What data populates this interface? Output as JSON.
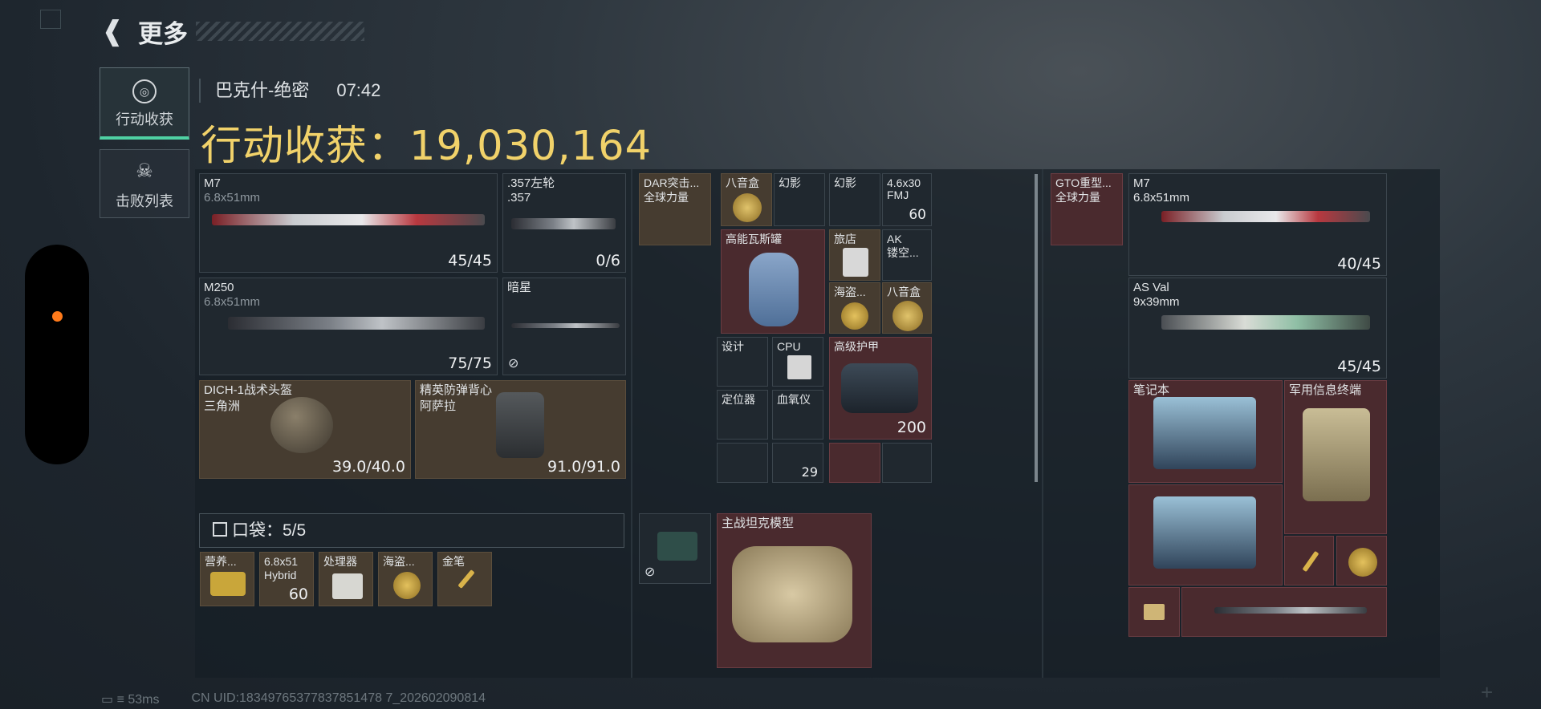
{
  "header": {
    "title": "更多"
  },
  "nav": {
    "tab1": "行动收获",
    "tab2": "击败列表"
  },
  "map": {
    "name": "巴克什-绝密",
    "time": "07:42"
  },
  "income": {
    "label": "行动收获：",
    "value": "19,030,164"
  },
  "weapons": [
    {
      "name": "M7",
      "ammo": "6.8x51mm",
      "count": "45/45"
    },
    {
      "name": ".357左轮",
      "ammo": ".357",
      "count": "0/6"
    },
    {
      "name": "M250",
      "ammo": "6.8x51mm",
      "count": "75/75"
    },
    {
      "name": "暗星"
    }
  ],
  "armor": [
    {
      "name": "DICH-1战术头盔",
      "sub": "三角洲",
      "dur": "39.0/40.0"
    },
    {
      "name": "精英防弹背心",
      "sub": "阿萨拉",
      "dur": "91.0/91.0"
    }
  ],
  "pocket": {
    "label": "口袋：5/5",
    "items": [
      "营养...",
      "6.8x51 Hybrid",
      "处理器",
      "海盗...",
      "金笔"
    ],
    "count2": "60"
  },
  "bag": {
    "rig": "DAR突击...",
    "rig_sub": "全球力量",
    "items": {
      "bayin1": "八音盒",
      "huanying1": "幻影",
      "huanying2": "幻影",
      "ammo46": "4.6x30",
      "ammo46_sub": "FMJ",
      "ammo46_count": "60",
      "gas": "高能瓦斯罐",
      "lvdian": "旅店",
      "ak": "AK",
      "ak_sub": "镂空...",
      "haidao": "海盗...",
      "bayin2": "八音盒",
      "sheji": "设计",
      "cpu": "CPU",
      "hujia": "高级护甲",
      "hujia_val": "200",
      "dingwei": "定位器",
      "xueyang": "血氧仪",
      "num29": "29",
      "tank": "主战坦克模型"
    }
  },
  "right": {
    "rig": "GTO重型...",
    "rig_sub": "全球力量",
    "m7": {
      "name": "M7",
      "ammo": "6.8x51mm",
      "count": "40/45"
    },
    "asval": {
      "name": "AS Val",
      "ammo": "9x39mm",
      "count": "45/45"
    },
    "laptop": "笔记本",
    "terminal": "军用信息终端"
  },
  "footer": {
    "ping": "53ms",
    "uid": "CN UID:18349765377837851478 7_202602090814"
  },
  "colors": {
    "accent": "#f1d26a",
    "green": "#4fd1a3",
    "red_bg": "#4a2a2e",
    "gold_bg": "#463c30"
  }
}
